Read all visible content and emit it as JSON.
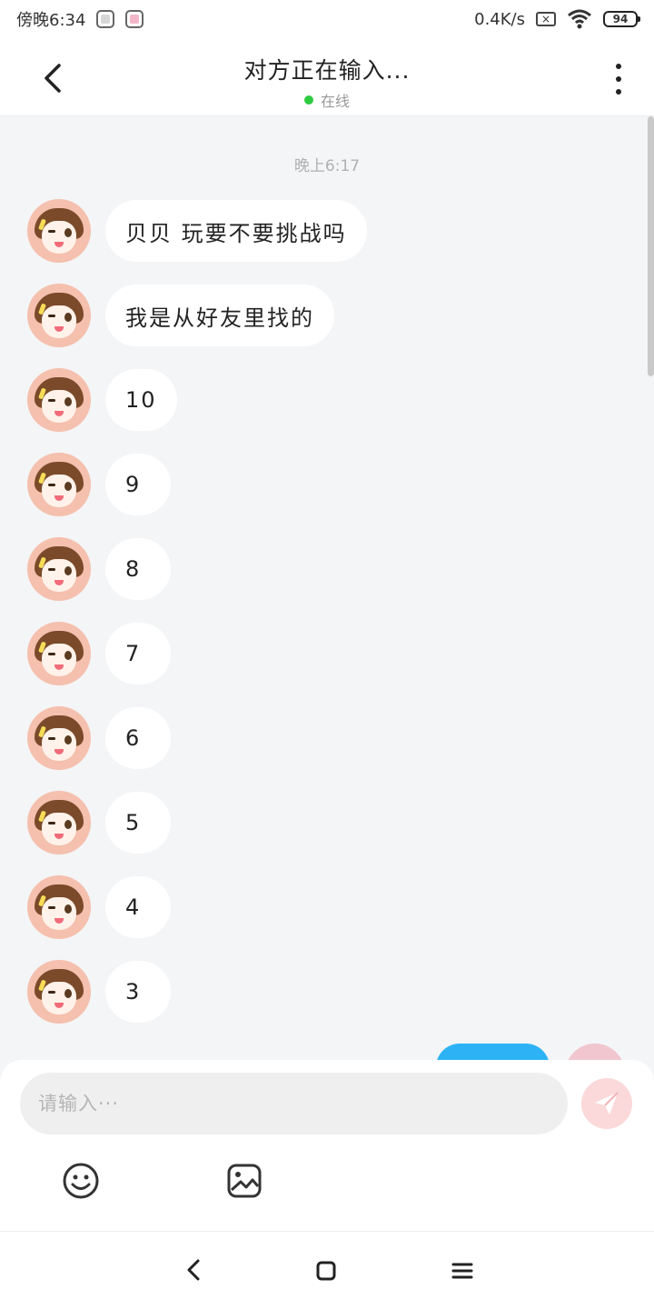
{
  "status_bar": {
    "time": "傍晚6:34",
    "network_speed": "0.4K/s",
    "battery": "94",
    "icons": [
      "gallery-icon",
      "notification-app-icon",
      "sim-disabled-icon",
      "wifi-icon",
      "battery-icon"
    ]
  },
  "header": {
    "back_icon": "chevron-left-icon",
    "title": "对方正在输入...",
    "status": "在线",
    "status_color": "#2ecc40",
    "more_icon": "more-vertical-icon"
  },
  "chat": {
    "timestamp": "晚上6:17",
    "messages": [
      {
        "sender": "other",
        "text": "贝贝 玩要不要挑战吗"
      },
      {
        "sender": "other",
        "text": "我是从好友里找的"
      },
      {
        "sender": "other",
        "text": "10"
      },
      {
        "sender": "other",
        "text": "9"
      },
      {
        "sender": "other",
        "text": "8"
      },
      {
        "sender": "other",
        "text": "7"
      },
      {
        "sender": "other",
        "text": "6"
      },
      {
        "sender": "other",
        "text": "5"
      },
      {
        "sender": "other",
        "text": "4"
      },
      {
        "sender": "other",
        "text": "3"
      }
    ]
  },
  "composer": {
    "placeholder": "请输入···",
    "send_icon": "send-icon",
    "emoji_icon": "emoji-icon",
    "image_icon": "image-icon"
  },
  "nav_bar": {
    "back_icon": "nav-back-icon",
    "home_icon": "nav-home-icon",
    "recent_icon": "nav-recent-icon"
  },
  "colors": {
    "accent": "#2db3f5",
    "background": "#f4f5f7",
    "bubble": "#ffffff"
  }
}
